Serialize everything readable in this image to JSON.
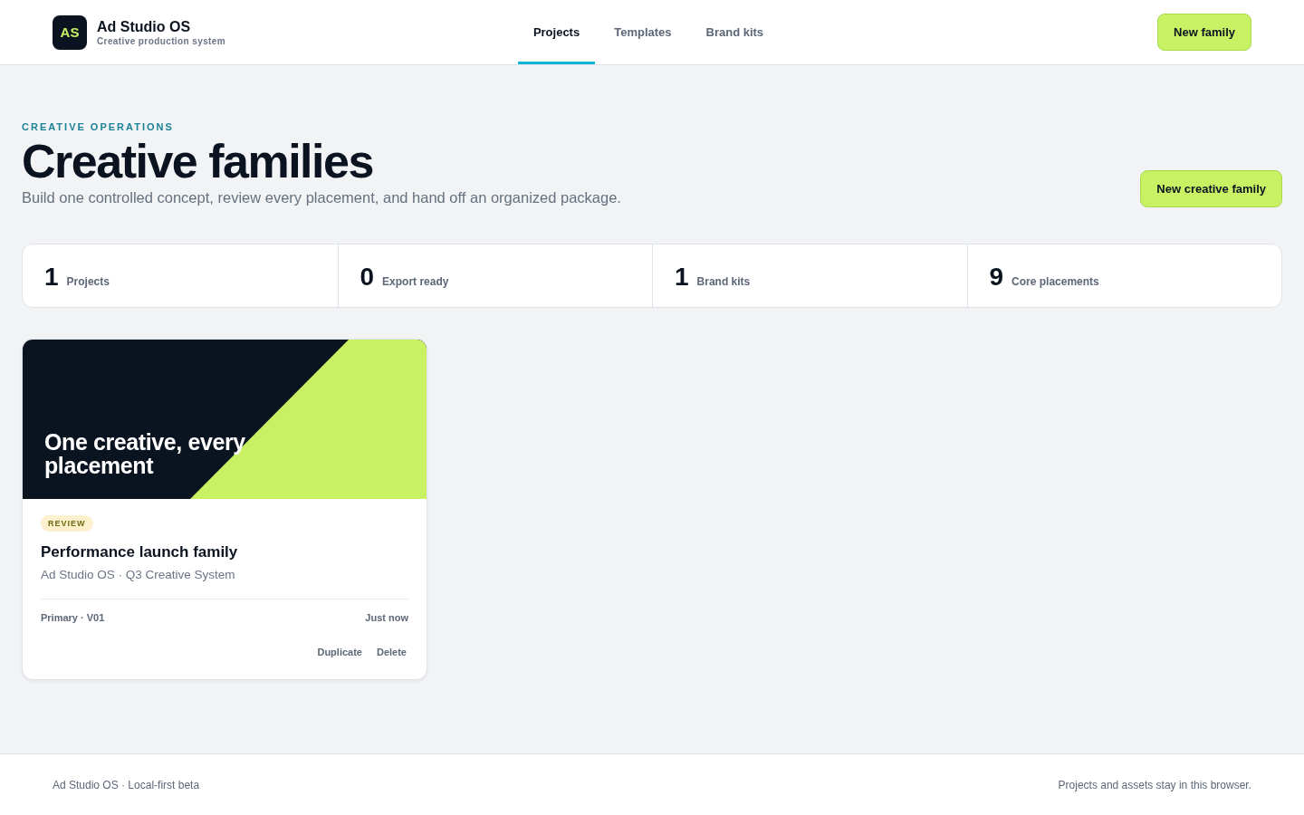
{
  "app": {
    "logo": "AS",
    "name": "Ad Studio OS",
    "tagline": "Creative production system"
  },
  "nav": [
    {
      "label": "Projects",
      "selected": true
    },
    {
      "label": "Templates",
      "selected": false
    },
    {
      "label": "Brand kits",
      "selected": false
    }
  ],
  "header_button": "New family",
  "page": {
    "eyebrow": "CREATIVE OPERATIONS",
    "title": "Creative families",
    "subtitle": "Build one controlled concept, review every placement, and hand off an organized package.",
    "button": "New creative family"
  },
  "stats": [
    {
      "value": "1",
      "label": "Projects"
    },
    {
      "value": "0",
      "label": "Export ready"
    },
    {
      "value": "1",
      "label": "Brand kits"
    },
    {
      "value": "9",
      "label": "Core placements"
    }
  ],
  "projects": [
    {
      "cover_title": "One creative, every placement",
      "status": "REVIEW",
      "title": "Performance launch family",
      "subtitle": "Ad Studio OS · Q3 Creative System",
      "version": "Primary · V01",
      "updated": "Just now",
      "actions": [
        "Duplicate",
        "Delete"
      ]
    }
  ],
  "footer": {
    "left": "Ad Studio OS · Local-first beta",
    "right": "Projects and assets stay in this browser."
  }
}
